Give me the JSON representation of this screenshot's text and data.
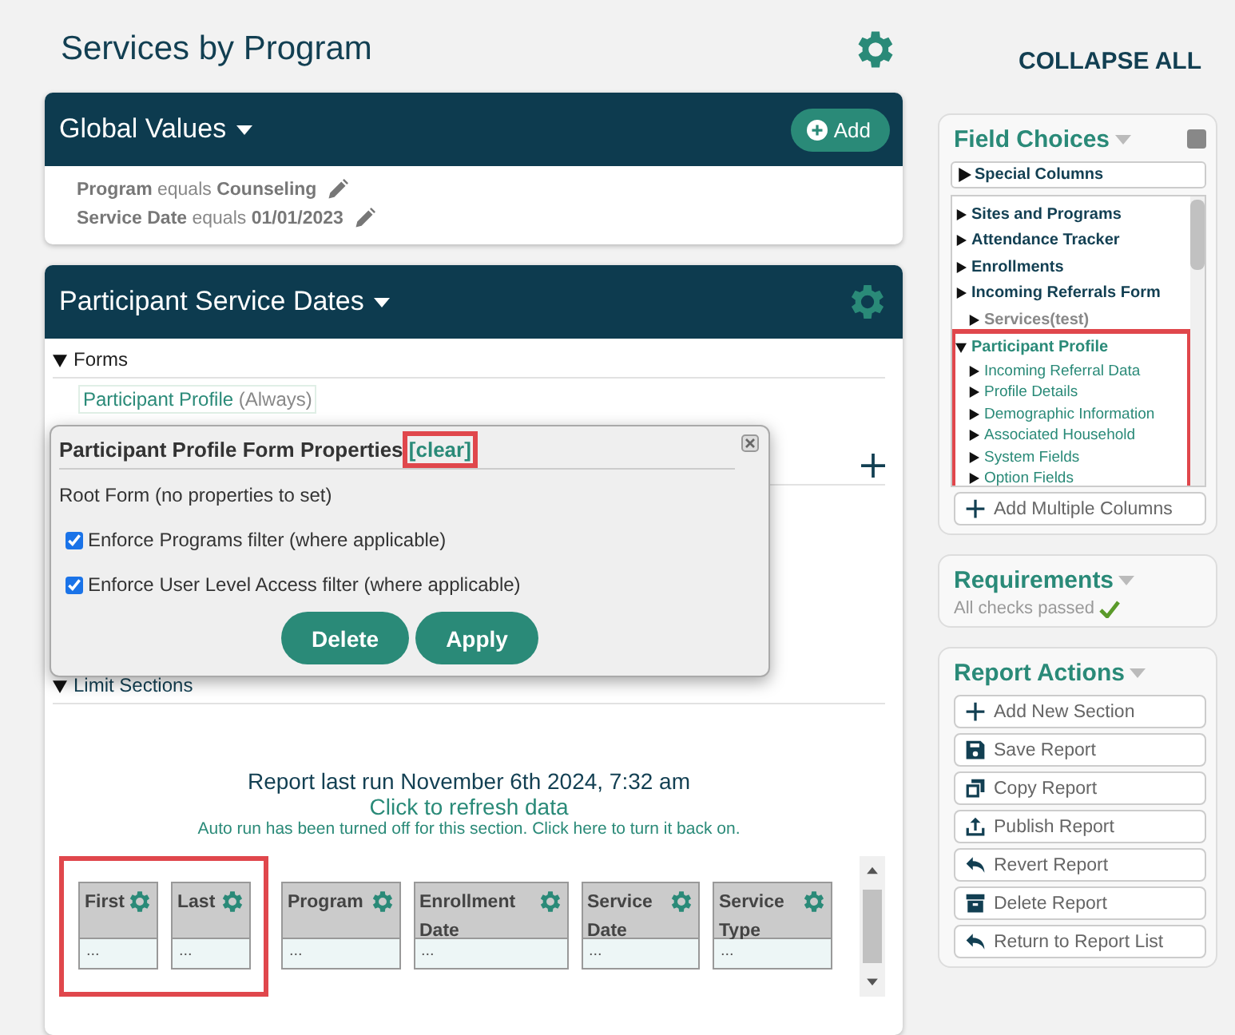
{
  "page_title": "Services by Program",
  "collapse_all": "COLLAPSE ALL",
  "global_values": {
    "title": "Global Values",
    "add_button": "Add",
    "filters": [
      {
        "field": "Program",
        "operator": "equals",
        "value": "Counseling"
      },
      {
        "field": "Service Date",
        "operator": "equals",
        "value": "01/01/2023"
      }
    ]
  },
  "section": {
    "title": "Participant Service Dates",
    "forms_label": "Forms",
    "forms_expanded": true,
    "form_tag": {
      "name": "Participant Profile",
      "note": "(Always)"
    },
    "limit_label": "Limit Sections",
    "limit_expanded": true,
    "report_last_run": "Report last run November 6th 2024, 7:32 am",
    "refresh_link": "Click to refresh data",
    "auto_run_note": "Auto run has been turned off for this section. Click here to turn it back on.",
    "columns": [
      {
        "label": "First",
        "value": "...",
        "highlighted": true
      },
      {
        "label": "Last",
        "value": "...",
        "highlighted": true
      },
      {
        "label": "Program",
        "value": "...",
        "highlighted": false
      },
      {
        "label": "Enrollment Date",
        "value": "...",
        "highlighted": false
      },
      {
        "label": "Service Date",
        "value": "...",
        "highlighted": false
      },
      {
        "label": "Service Type",
        "value": "...",
        "highlighted": false
      }
    ]
  },
  "dialog": {
    "title": "Participant Profile Form Properties",
    "clear_link": "[clear]",
    "clear_highlighted": true,
    "root_note": "Root Form (no properties to set)",
    "options": [
      {
        "label": "Enforce Programs filter (where applicable)",
        "checked": true
      },
      {
        "label": "Enforce User Level Access filter (where applicable)",
        "checked": true
      }
    ],
    "buttons": [
      "Delete",
      "Apply"
    ]
  },
  "field_choices": {
    "title": "Field Choices",
    "special": "Special Columns",
    "tree": [
      {
        "label": "Sites and Programs",
        "expanded": false,
        "disabled": false,
        "highlighted": false
      },
      {
        "label": "Attendance Tracker",
        "expanded": false,
        "disabled": false,
        "highlighted": false
      },
      {
        "label": "Enrollments",
        "expanded": false,
        "disabled": false,
        "highlighted": false
      },
      {
        "label": "Incoming Referrals Form",
        "expanded": false,
        "disabled": false,
        "highlighted": false,
        "children": [
          {
            "label": "Services(test)",
            "expanded": false,
            "disabled": true,
            "highlighted": false
          }
        ]
      },
      {
        "label": "Participant Profile",
        "expanded": true,
        "disabled": false,
        "highlighted": true,
        "children": [
          {
            "label": "Incoming Referral Data",
            "expanded": false,
            "disabled": false,
            "highlighted": false
          },
          {
            "label": "Profile Details",
            "expanded": false,
            "disabled": false,
            "highlighted": false
          },
          {
            "label": "Demographic Information",
            "expanded": false,
            "disabled": false,
            "highlighted": false
          },
          {
            "label": "Associated Household",
            "expanded": false,
            "disabled": false,
            "highlighted": false
          },
          {
            "label": "System Fields",
            "expanded": false,
            "disabled": false,
            "highlighted": false
          },
          {
            "label": "Option Fields",
            "expanded": false,
            "disabled": false,
            "highlighted": false
          }
        ]
      }
    ],
    "add_columns": "Add Multiple Columns"
  },
  "requirements": {
    "title": "Requirements",
    "status": "All checks passed",
    "passed": true
  },
  "report_actions": {
    "title": "Report Actions",
    "actions": [
      {
        "label": "Add New Section",
        "kind": "plus"
      },
      {
        "label": "Save Report",
        "kind": "save"
      },
      {
        "label": "Copy Report",
        "kind": "copy"
      },
      {
        "label": "Publish Report",
        "kind": "publish"
      },
      {
        "label": "Revert Report",
        "kind": "revert"
      },
      {
        "label": "Delete Report",
        "kind": "delete"
      },
      {
        "label": "Return to Report List",
        "kind": "return"
      }
    ]
  }
}
